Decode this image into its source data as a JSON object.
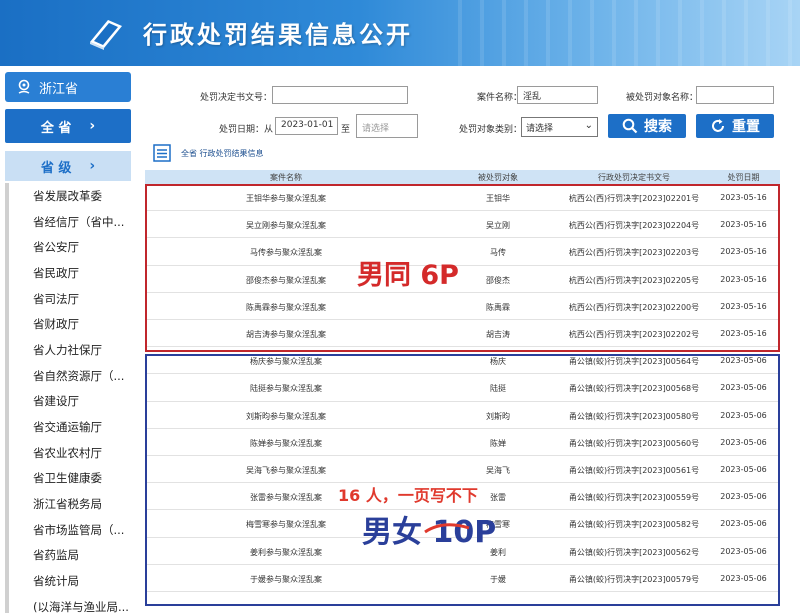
{
  "banner": {
    "title": "行政处罚结果信息公开"
  },
  "sidebar": {
    "province": "浙江省",
    "all_button": "全 省",
    "level_button": "省 级",
    "chevron": "›",
    "items": [
      "省发展改革委",
      "省经信厅（省中...",
      "省公安厅",
      "省民政厅",
      "省司法厅",
      "省财政厅",
      "省人力社保厅",
      "省自然资源厅（...",
      "省建设厅",
      "省交通运输厅",
      "省农业农村厅",
      "省卫生健康委",
      "浙江省税务局",
      "省市场监管局（...",
      "省药监局",
      "省统计局",
      "(以海洋与渔业局..."
    ]
  },
  "search": {
    "doc_no_label": "处罚决定书文号：",
    "doc_no_value": "",
    "case_name_label": "案件名称：",
    "case_name_value": "淫乱",
    "target_name_label": "被处罚对象名称：",
    "target_name_value": "",
    "date_label": "处罚日期：从",
    "date_from": "2023-01-01",
    "date_to_label": "至",
    "date_to_placeholder": "请选择",
    "target_type_label": "处罚对象类别：",
    "target_type_value": "请选择",
    "search_button": "搜索",
    "reset_button": "重置"
  },
  "breadcrumb": "全省 行政处罚结果信息",
  "table": {
    "headers": [
      "案件名称",
      "被处罚对象",
      "行政处罚决定书文号",
      "处罚日期"
    ],
    "rows": [
      [
        "王钼华参与聚众淫乱案",
        "王钼华",
        "杭西公(西)行罚决字[2023]02201号",
        "2023-05-16"
      ],
      [
        "吴立刚参与聚众淫乱案",
        "吴立刚",
        "杭西公(西)行罚决字[2023]02204号",
        "2023-05-16"
      ],
      [
        "马传参与聚众淫乱案",
        "马传",
        "杭西公(西)行罚决字[2023]02203号",
        "2023-05-16"
      ],
      [
        "邵俊杰参与聚众淫乱案",
        "邵俊杰",
        "杭西公(西)行罚决字[2023]02205号",
        "2023-05-16"
      ],
      [
        "陈禹霖参与聚众淫乱案",
        "陈禹霖",
        "杭西公(西)行罚决字[2023]02200号",
        "2023-05-16"
      ],
      [
        "胡吉涛参与聚众淫乱案",
        "胡吉涛",
        "杭西公(西)行罚决字[2023]02202号",
        "2023-05-16"
      ],
      [
        "杨庆参与聚众淫乱案",
        "杨庆",
        "甬公镇(蛟)行罚决字[2023]00564号",
        "2023-05-06"
      ],
      [
        "陆挺参与聚众淫乱案",
        "陆挺",
        "甬公镇(蛟)行罚决字[2023]00568号",
        "2023-05-06"
      ],
      [
        "刘斯昀参与聚众淫乱案",
        "刘斯昀",
        "甬公镇(蛟)行罚决字[2023]00580号",
        "2023-05-06"
      ],
      [
        "陈婵参与聚众淫乱案",
        "陈婵",
        "甬公镇(蛟)行罚决字[2023]00560号",
        "2023-05-06"
      ],
      [
        "吴海飞参与聚众淫乱案",
        "吴海飞",
        "甬公镇(蛟)行罚决字[2023]00561号",
        "2023-05-06"
      ],
      [
        "张雷参与聚众淫乱案",
        "张雷",
        "甬公镇(蛟)行罚决字[2023]00559号",
        "2023-05-06"
      ],
      [
        "梅雪寒参与聚众淫乱案",
        "梅雪寒",
        "甬公镇(蛟)行罚决字[2023]00582号",
        "2023-05-06"
      ],
      [
        "姜利参与聚众淫乱案",
        "姜利",
        "甬公镇(蛟)行罚决字[2023]00562号",
        "2023-05-06"
      ],
      [
        "于媛参与聚众淫乱案",
        "于媛",
        "甬公镇(蛟)行罚决字[2023]00579号",
        "2023-05-06"
      ]
    ]
  },
  "annotations": {
    "red_label": "男同 6P",
    "note": "16 人，一页写不下",
    "blue_label_a": "男女 ",
    "blue_label_b": "10P"
  },
  "colors": {
    "banner": "#1a6fc4",
    "button": "#1d6fc7",
    "red": "#c0262c",
    "blue": "#2a3f9a"
  }
}
